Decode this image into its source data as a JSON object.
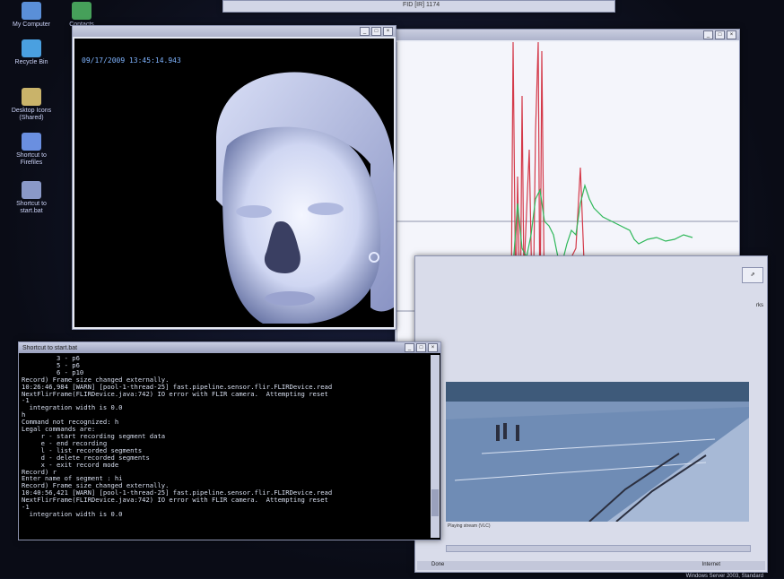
{
  "desktop": {
    "icons": [
      {
        "label": "My Computer",
        "icon": "computer-icon",
        "color": "#5a8fd8"
      },
      {
        "label": "Recycle Bin",
        "icon": "recycle-bin-icon",
        "color": "#4aa0e0"
      },
      {
        "label": "Desktop Icons (Shared)",
        "icon": "folder-icon",
        "color": "#c9b36a"
      },
      {
        "label": "Shortcut to Firefiles",
        "icon": "shortcut-icon",
        "color": "#6a8fe0"
      },
      {
        "label": "Shortcut to start.bat",
        "icon": "batch-file-icon",
        "color": "#8a99c8"
      }
    ],
    "extra_icon_label": "Contacts"
  },
  "top_window": {
    "title": "FID [IR] 1174"
  },
  "thermal_window": {
    "timestamp": "09/17/2009 13:45:14.943"
  },
  "graph_window": {
    "colors": {
      "red": "#d43a4a",
      "green": "#2fb85a",
      "blue": "#6a84c8",
      "axis": "#6d7390"
    }
  },
  "console_window": {
    "title": "Shortcut to start.bat",
    "lines": [
      "         3 - p6",
      "         5 - p6",
      "         6 - p10",
      "Record) Frame size changed externally.",
      "10:26:46,984 [WARN] [pool-1-thread-25] fast.pipeline.sensor.flir.FLIRDevice.read",
      "NextFlirFrame(FLIRDevice.java:742) IO error with FLIR camera.  Attempting reset",
      "-1",
      "  integration width is 0.0",
      "h",
      "Command not recognized: h",
      "Legal commands are:",
      "     r - start recording segment data",
      "     e - end recording",
      "     l - list recorded segments",
      "     d - delete recorded segments",
      "     x - exit record mode",
      "Record) r",
      "Enter name of segment : hi",
      "Record) Frame size changed externally.",
      "10:40:56,421 [WARN] [pool-1-thread-25] fast.pipeline.sensor.flir.FLIRDevice.read",
      "NextFlirFrame(FLIRDevice.java:742) IO error with FLIR camera.  Attempting reset",
      "-1",
      "  integration width is 0.0"
    ]
  },
  "camera_window": {
    "side_label": "rks",
    "feed_caption": "Playing stream (VLC)",
    "status_left": "Done",
    "status_right": "Internet",
    "taskbar_text": "Windows Server 2003, Standard"
  }
}
